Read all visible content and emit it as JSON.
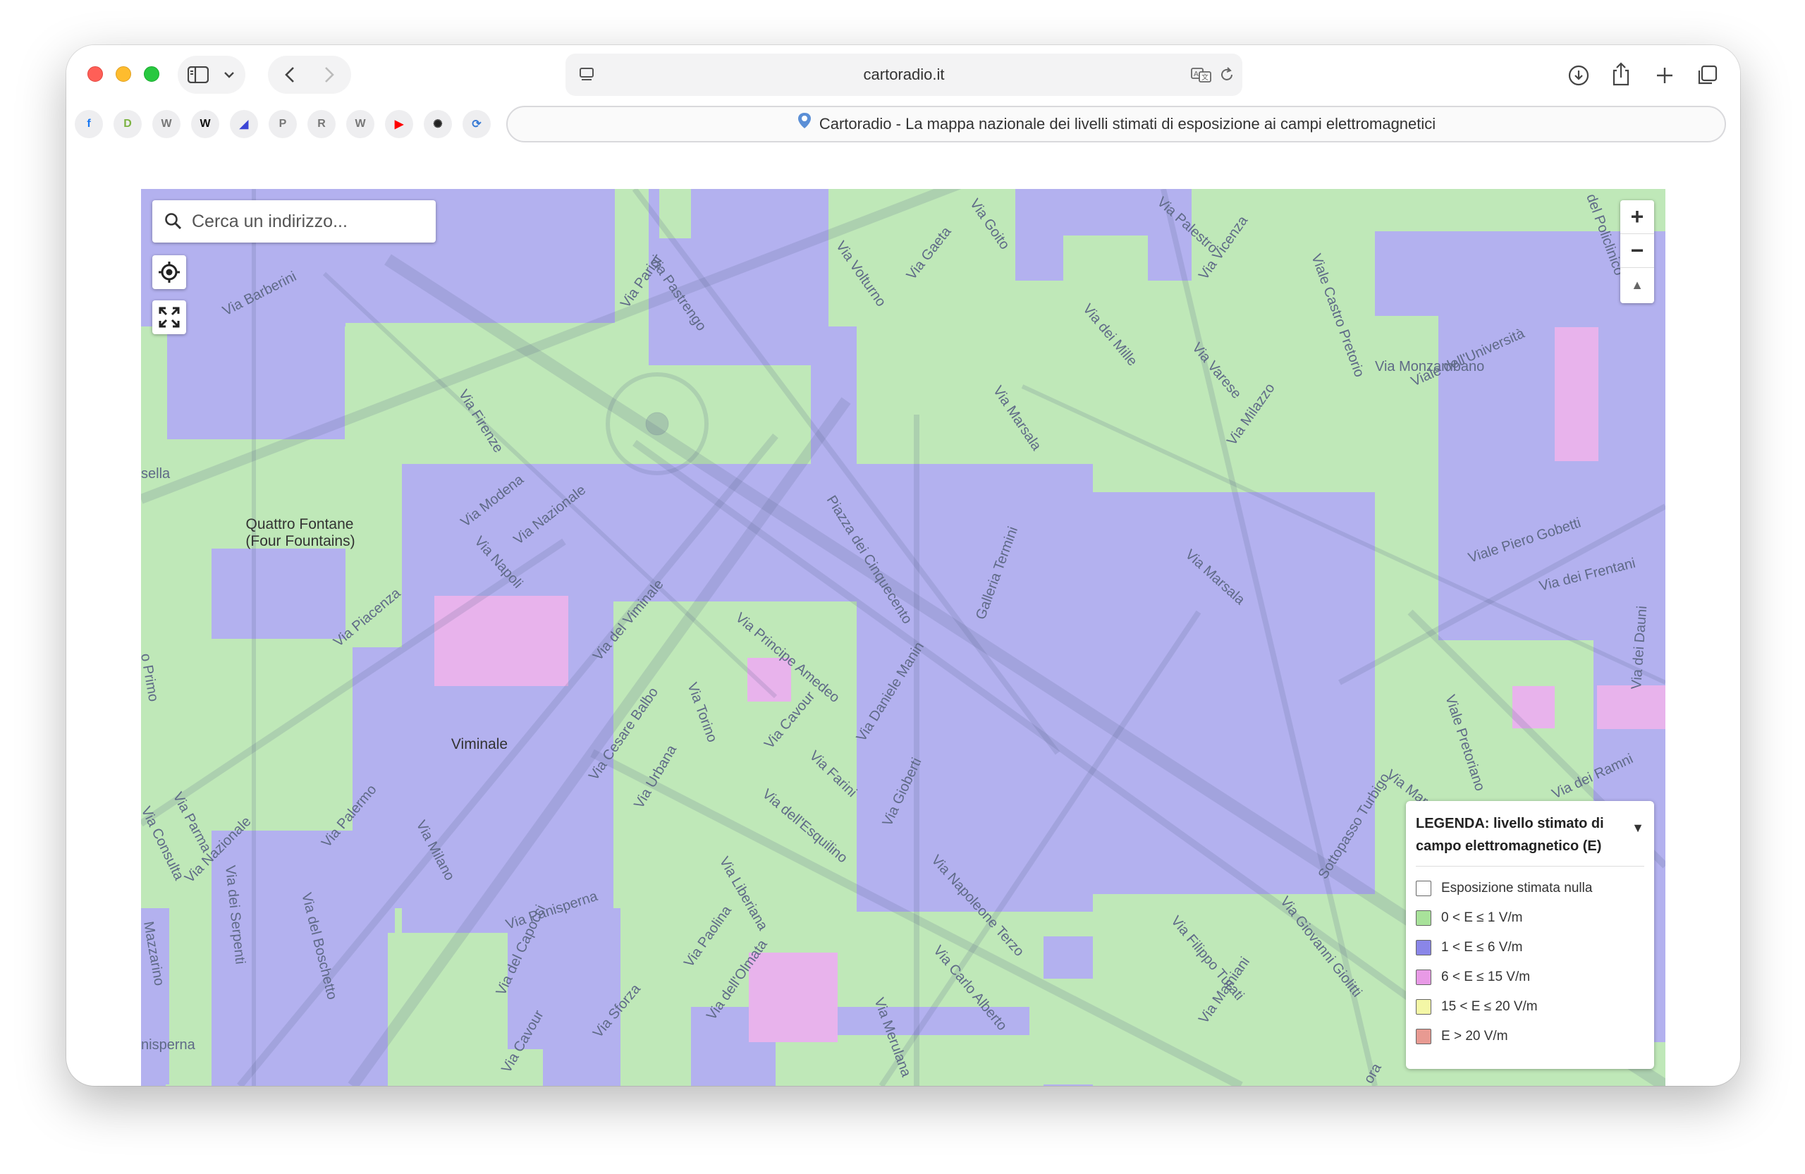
{
  "browser": {
    "url": "cartoradio.it",
    "tab_title": "Cartoradio - La mappa nazionale dei livelli stimati di esposizione ai campi elettromagnetici",
    "bookmarks": [
      {
        "name": "facebook",
        "glyph": "f",
        "color": "#1877f2"
      },
      {
        "name": "d-bookmark",
        "glyph": "D",
        "color": "#7cb342"
      },
      {
        "name": "w-bookmark",
        "glyph": "W",
        "color": "#777777"
      },
      {
        "name": "wikipedia",
        "glyph": "W",
        "color": "#111111"
      },
      {
        "name": "app-bookmark",
        "glyph": "◢",
        "color": "#3b45d6"
      },
      {
        "name": "p-bookmark",
        "glyph": "P",
        "color": "#777777"
      },
      {
        "name": "r-bookmark",
        "glyph": "R",
        "color": "#777777"
      },
      {
        "name": "w-bookmark-2",
        "glyph": "W",
        "color": "#777777"
      },
      {
        "name": "youtube",
        "glyph": "▶",
        "color": "#ff0000"
      },
      {
        "name": "openai",
        "glyph": "✺",
        "color": "#222222"
      },
      {
        "name": "sync",
        "glyph": "⟳",
        "color": "#3a7bd5"
      }
    ]
  },
  "map": {
    "search_placeholder": "Cerca un indirizzo...",
    "zoom_in": "+",
    "zoom_out": "−",
    "compass": "▲",
    "places": {
      "quattro_fontane": "Quattro Fontane",
      "four_fountains": "(Four Fountains)",
      "viminale": "Viminale"
    },
    "streets": {
      "via_barberini": "Via Barberini",
      "via_pastrengo": "Via Pastrengo",
      "via_parigi": "Via Parigi",
      "via_volturno": "Via Volturno",
      "via_gaeta": "Via Gaeta",
      "via_goito": "Via Goito",
      "via_palestro": "Via Palestro",
      "via_vicenza": "Via Vicenza",
      "viale_castro_pretorio": "Viale Castro Pretorio",
      "viale_policlinico": "del Policlinico",
      "via_monzambano": "Via Monzambano",
      "viale_universita": "Viale dell'Università",
      "via_dei_mille": "Via dei Mille",
      "via_varese": "Via Varese",
      "via_milazzo": "Via Milazzo",
      "via_marsala": "Via Marsala",
      "via_firenze": "Via Firenze",
      "via_modena": "Via Modena",
      "via_nazionale": "Via Nazionale",
      "via_napoli": "Via Napoli",
      "piazza_cinquecento": "Piazza dei Cinquecento",
      "galleria_termini": "Galleria Termini",
      "viale_piero_gobetti": "Viale Piero Gobetti",
      "via_dei_frentani": "Via dei Frentani",
      "via_dei_dauni": "Via dei Dauni",
      "via_piacenza": "Via Piacenza",
      "via_del_viminale": "Via del Viminale",
      "via_principe_amedeo": "Via Principe Amedeo",
      "via_daniele_manin": "Via Daniele Manin",
      "via_torino": "Via Torino",
      "via_cavour": "Via Cavour",
      "via_cesare_balbo": "Via Cesare Balbo",
      "via_urbana": "Via Urbana",
      "via_farini": "Via Farini",
      "via_gioberti": "Via Gioberti",
      "sottopasso_turbigo": "Sottopasso Turbigo",
      "viale_pretoriano": "Viale Pretoriano",
      "via_dei_ramni": "Via dei Ramni",
      "via_parma": "Via Parma",
      "via_consulta": "Via Consulta",
      "via_palermo": "Via Palermo",
      "via_milano": "Via Milano",
      "via_dei_serpenti": "Via dei Serpenti",
      "via_del_boschetto": "Via del Boschetto",
      "via_panisperna": "Via Panisperna",
      "via_del_capocci": "Via del Capocci",
      "via_cavour_2": "Via Cavour",
      "via_sforza": "Via Sforza",
      "via_paolina": "Via Paolina",
      "via_dell_olmata": "Via dell'Olmata",
      "via_liberiana": "Via Liberiana",
      "via_dell_esquilino": "Via dell'Esquilino",
      "via_merulana": "Via Merulana",
      "via_napoleone_terzo": "Via Napoleone Terzo",
      "via_carlo_alberto": "Via Carlo Alberto",
      "via_filippo_turati": "Via Filippo Turati",
      "via_giovanni_giolitti": "Via Giovanni Giolitti",
      "via_mamiani": "Via Mamiani",
      "mazzarino": "Mazzarino",
      "panisperna_left": "nisperna",
      "sella": "sella",
      "primo": "o Primo",
      "ora": "ora"
    }
  },
  "legend": {
    "title": "LEGENDA: livello stimato di campo elettromagnetico (E)",
    "toggle": "▼",
    "items": [
      {
        "label": "Esposizione stimata nulla",
        "color": "#ffffff"
      },
      {
        "label": "0 < E ≤ 1 V/m",
        "color": "#a8e29a"
      },
      {
        "label": "1 < E ≤ 6 V/m",
        "color": "#8a86e8"
      },
      {
        "label": "6 < E ≤ 15 V/m",
        "color": "#e89ae6"
      },
      {
        "label": "15 < E ≤ 20 V/m",
        "color": "#f4f7a6"
      },
      {
        "label": "E > 20 V/m",
        "color": "#e89a92"
      }
    ]
  },
  "colors": {
    "green": "#bfe8b8",
    "purple": "#b3b1ef",
    "pink": "#e8b3ec"
  }
}
